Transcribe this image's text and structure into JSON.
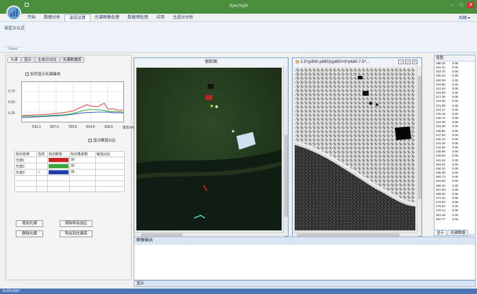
{
  "app": {
    "title": "SpecSight"
  },
  "window_controls": {
    "minimize": "–",
    "maximize": "□",
    "close": "✕"
  },
  "tabs": [
    "开始",
    "数据分析",
    "波段运算",
    "光谱图像处理",
    "数据预处理",
    "应用",
    "主成分分析"
  ],
  "active_tab_index": 2,
  "help_label": "风格 ▾",
  "ribbon": {
    "button_label": "自定义公式",
    "group_label": "Panel"
  },
  "left_panel": {
    "tabs": [
      "光谱",
      "显示",
      "主成分占比",
      "光谱数据库"
    ],
    "realtime_checkbox": "实时显示光谱曲线",
    "curve_yticks": [
      "0.75",
      "0.50",
      "0.25"
    ],
    "curve_xticks": [
      "513.1",
      "607.0",
      "700.9",
      "814.6",
      "918.5"
    ],
    "curve_xunit": "波长/nm",
    "ok_checkbox": "显示解混占比",
    "table": {
      "headers": [
        "标识名称",
        "当前",
        "标识颜色",
        "标识像素数",
        "解混占比"
      ],
      "rows": [
        {
          "name": "光谱1",
          "current": "",
          "color": "#d02020",
          "pixels": "39",
          "ratio": ""
        },
        {
          "name": "光谱2",
          "current": "",
          "color": "#3aa83a",
          "pixels": "35",
          "ratio": ""
        },
        {
          "name": "光谱3",
          "current": "✓",
          "color": "#1f3fb0",
          "pixels": "28",
          "ratio": ""
        }
      ]
    },
    "buttons": {
      "add": "增加光谱",
      "clear_all": "清除所有选区",
      "delete": "删除光谱",
      "export": "导出到光谱库"
    }
  },
  "colors": {
    "curve_red": "#d84040",
    "curve_green": "#3aa83a",
    "curve_blue": "#3060c0",
    "accent": "#4a8f3e"
  },
  "image_window_1": {
    "title": "假彩图"
  },
  "image_window_2": {
    "title": "2.5*(p800-p680)/(p800+6*p680-7.5*..."
  },
  "right_list": {
    "header": "值图",
    "rows": [
      [
        "396.26",
        "0.05"
      ],
      [
        "401.32",
        "0.05"
      ],
      [
        "403.75",
        "0.05"
      ],
      [
        "406.04",
        "0.05"
      ],
      [
        "408.38",
        "0.05"
      ],
      [
        "410.56",
        "0.05"
      ],
      [
        "412.82",
        "0.05"
      ],
      [
        "415.09",
        "0.06"
      ],
      [
        "417.36",
        "0.06"
      ],
      [
        "419.63",
        "0.06"
      ],
      [
        "421.90",
        "0.06"
      ],
      [
        "424.17",
        "0.05"
      ],
      [
        "426.45",
        "0.05"
      ],
      [
        "428.72",
        "0.05"
      ],
      [
        "431.00",
        "0.05"
      ],
      [
        "433.28",
        "0.05"
      ],
      [
        "435.56",
        "0.05"
      ],
      [
        "437.84",
        "0.05"
      ],
      [
        "440.12",
        "0.05"
      ],
      [
        "442.40",
        "0.05"
      ],
      [
        "444.68",
        "0.05"
      ],
      [
        "446.96",
        "0.05"
      ],
      [
        "449.25",
        "0.05"
      ],
      [
        "451.53",
        "0.05"
      ],
      [
        "453.81",
        "0.05"
      ],
      [
        "456.10",
        "0.05"
      ],
      [
        "458.38",
        "0.05"
      ],
      [
        "460.73",
        "0.05"
      ],
      [
        "463.00",
        "0.05"
      ],
      [
        "465.32",
        "0.05"
      ],
      [
        "467.60",
        "0.05"
      ],
      [
        "469.92",
        "0.05"
      ],
      [
        "472.20",
        "0.05"
      ],
      [
        "474.50",
        "0.05"
      ],
      [
        "476.84",
        "0.05"
      ],
      [
        "479.13",
        "0.05"
      ],
      [
        "481.45",
        "0.05"
      ],
      [
        "483.77",
        "0.05"
      ]
    ]
  },
  "right_tabs": [
    "显示",
    "光谱数据"
  ],
  "log_panel": {
    "title": "图像输出"
  },
  "output_bar": {
    "label": "显示"
  },
  "status_bar": {
    "text": "N.SPLASH"
  }
}
